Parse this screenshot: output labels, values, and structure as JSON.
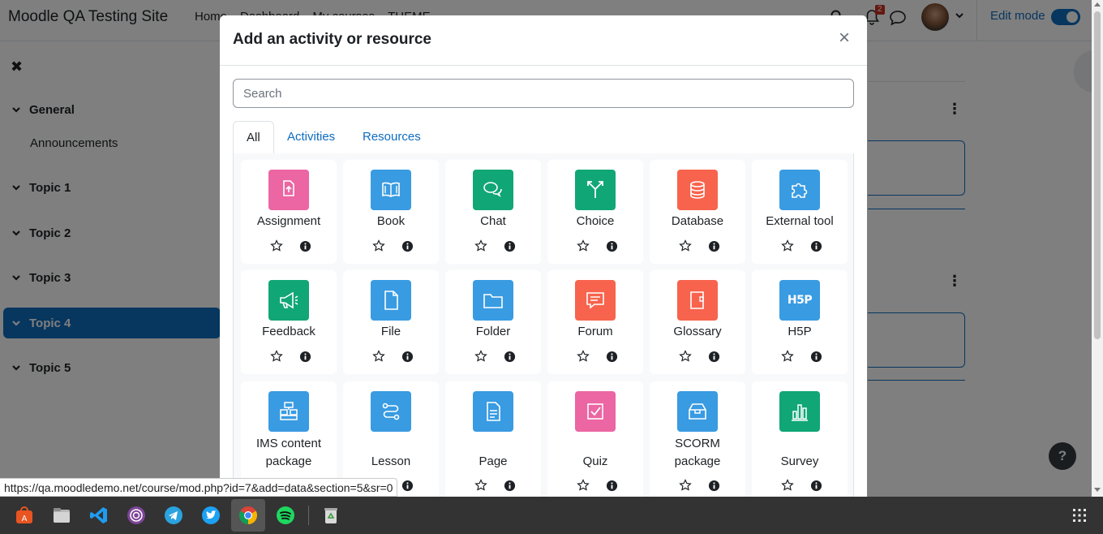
{
  "navbar": {
    "brand": "Moodle QA Testing Site",
    "links": [
      "Home",
      "Dashboard",
      "My courses",
      "THEME"
    ],
    "notification_count": "2",
    "edit_mode_label": "Edit mode"
  },
  "course_index": {
    "sections": [
      {
        "label": "General",
        "active": false
      },
      {
        "label": "Topic 1",
        "active": false
      },
      {
        "label": "Topic 2",
        "active": false
      },
      {
        "label": "Topic 3",
        "active": false
      },
      {
        "label": "Topic 4",
        "active": true
      },
      {
        "label": "Topic 5",
        "active": false
      }
    ],
    "general_child": "Announcements"
  },
  "modal": {
    "title": "Add an activity or resource",
    "close_symbol": "×",
    "search_placeholder": "Search",
    "tabs": [
      "All",
      "Activities",
      "Resources"
    ],
    "active_tab": "All",
    "items": [
      {
        "name": "Assignment",
        "color": "#eb66a2",
        "icon": "assignment-icon"
      },
      {
        "name": "Book",
        "color": "#399be2",
        "icon": "book-icon"
      },
      {
        "name": "Chat",
        "color": "#11a676",
        "icon": "chat-icon"
      },
      {
        "name": "Choice",
        "color": "#11a676",
        "icon": "choice-icon"
      },
      {
        "name": "Database",
        "color": "#f7634d",
        "icon": "database-icon"
      },
      {
        "name": "External tool",
        "color": "#399be2",
        "icon": "puzzle-icon"
      },
      {
        "name": "Feedback",
        "color": "#11a676",
        "icon": "megaphone-icon"
      },
      {
        "name": "File",
        "color": "#399be2",
        "icon": "file-icon"
      },
      {
        "name": "Folder",
        "color": "#399be2",
        "icon": "folder-icon"
      },
      {
        "name": "Forum",
        "color": "#f7634d",
        "icon": "forum-icon"
      },
      {
        "name": "Glossary",
        "color": "#f7634d",
        "icon": "glossary-icon"
      },
      {
        "name": "H5P",
        "color": "#399be2",
        "icon": "h5p-icon"
      },
      {
        "name": "IMS content package",
        "color": "#399be2",
        "icon": "ims-icon"
      },
      {
        "name": "Lesson",
        "color": "#399be2",
        "icon": "lesson-icon"
      },
      {
        "name": "Page",
        "color": "#399be2",
        "icon": "page-icon"
      },
      {
        "name": "Quiz",
        "color": "#eb66a2",
        "icon": "quiz-icon"
      },
      {
        "name": "SCORM package",
        "color": "#399be2",
        "icon": "scorm-icon"
      },
      {
        "name": "Survey",
        "color": "#11a676",
        "icon": "survey-icon"
      }
    ],
    "h5p_text": "H5P"
  },
  "help_label": "?",
  "status_url": "https://qa.moodledemo.net/course/mod.php?id=7&add=data&section=5&sr=0",
  "taskbar": {
    "apps": [
      "software-center-icon",
      "files-icon",
      "vscode-icon",
      "tor-browser-icon",
      "telegram-icon",
      "twitter-icon",
      "chrome-icon",
      "spotify-icon",
      "trash-icon"
    ]
  }
}
